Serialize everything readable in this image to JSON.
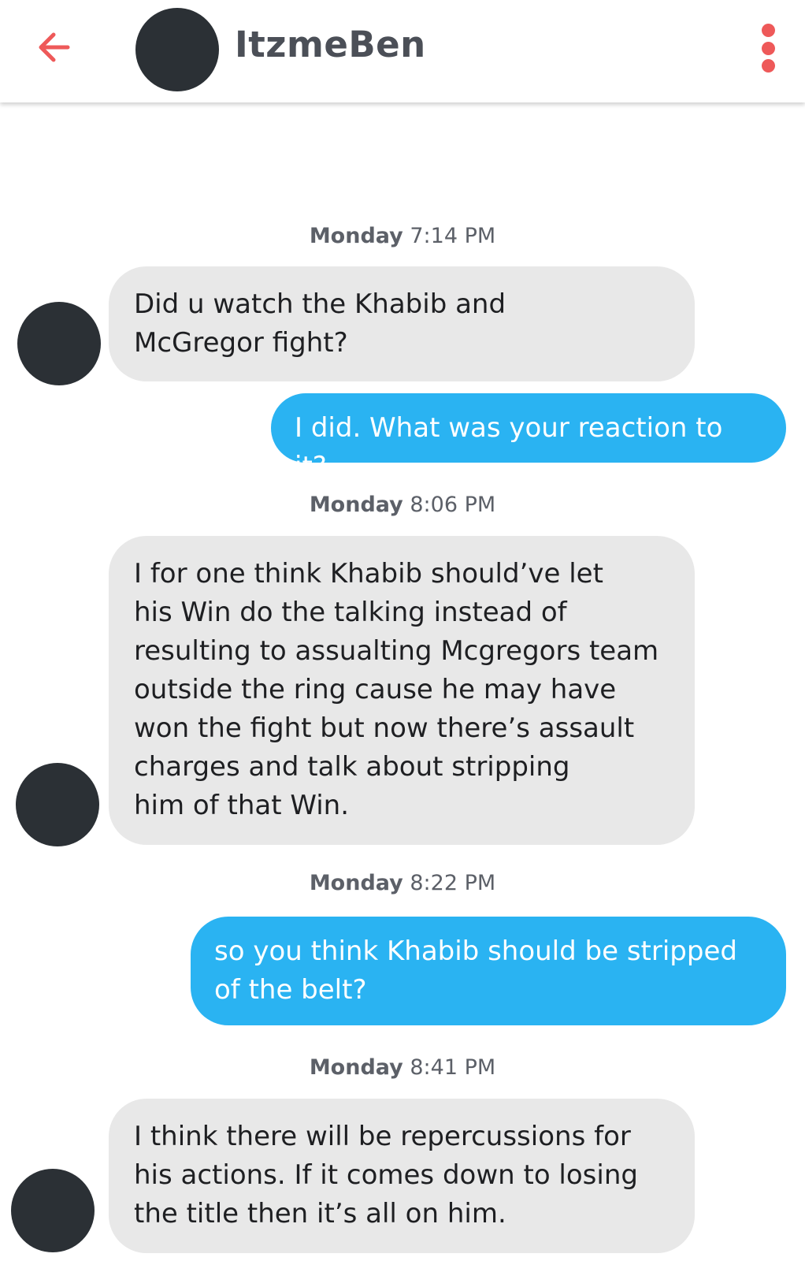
{
  "header": {
    "contact_name": "ItzmeBen",
    "back_icon": "arrow-left-icon",
    "menu_icon": "kebab-menu-icon",
    "accent_color": "#ee5959"
  },
  "colors": {
    "incoming_bubble": "#e8e8e8",
    "outgoing_bubble": "#2ab3f2"
  },
  "timestamps": [
    {
      "day": "Monday",
      "time": "7:14 PM"
    },
    {
      "day": "Monday",
      "time": "8:06 PM"
    },
    {
      "day": "Monday",
      "time": "8:22 PM"
    },
    {
      "day": "Monday",
      "time": "8:41 PM"
    }
  ],
  "messages": [
    {
      "direction": "incoming",
      "text": "Did u watch the Khabib and\nMcGregor fight?"
    },
    {
      "direction": "outgoing",
      "text": "I did. What was your reaction to it?"
    },
    {
      "direction": "incoming",
      "text": "I for one think Khabib should’ve let\nhis Win do the talking instead of\nresulting to assualting Mcgregors team\noutside the ring cause he may have\nwon the fight but now there’s assault\ncharges and talk about stripping\nhim of that Win."
    },
    {
      "direction": "outgoing",
      "text": "so you think Khabib should be stripped\nof the belt?"
    },
    {
      "direction": "incoming",
      "text": "I think there will be repercussions for\nhis actions. If it comes down to losing\nthe title then it’s all on him."
    }
  ]
}
